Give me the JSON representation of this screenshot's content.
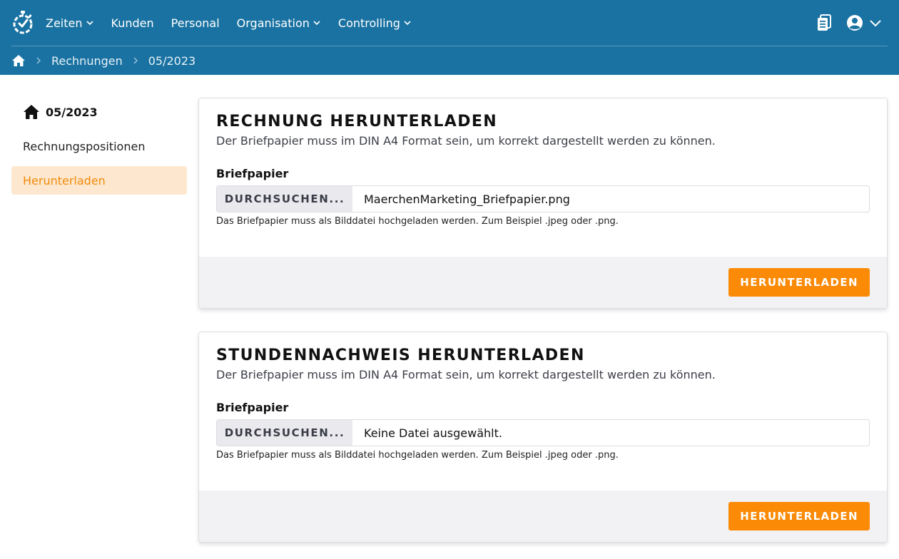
{
  "nav": {
    "items": [
      {
        "label": "Zeiten",
        "has_dropdown": true
      },
      {
        "label": "Kunden",
        "has_dropdown": false
      },
      {
        "label": "Personal",
        "has_dropdown": false
      },
      {
        "label": "Organisation",
        "has_dropdown": true
      },
      {
        "label": "Controlling",
        "has_dropdown": true
      }
    ],
    "logo_icon": "stopwatch-logo-icon",
    "right_icons": [
      "clipboard-icon",
      "user-circle-icon",
      "chevron-down-icon"
    ]
  },
  "breadcrumb": {
    "home_icon": "home-icon",
    "items": [
      "Rechnungen",
      "05/2023"
    ]
  },
  "sidebar": {
    "title": "05/2023",
    "items": [
      {
        "label": "Rechnungspositionen",
        "active": false
      },
      {
        "label": "Herunterladen",
        "active": true
      }
    ]
  },
  "cards": [
    {
      "title": "RECHNUNG HERUNTERLADEN",
      "subtitle": "Der Briefpapier muss im DIN A4 Format sein, um korrekt dargestellt werden zu können.",
      "field_label": "Briefpapier",
      "browse_label": "DURCHSUCHEN...",
      "file_name": "MaerchenMarketing_Briefpapier.png",
      "hint": "Das Briefpapier muss als Bilddatei hochgeladen werden. Zum Beispiel .jpeg oder .png.",
      "button_label": "HERUNTERLADEN"
    },
    {
      "title": "STUNDENNACHWEIS HERUNTERLADEN",
      "subtitle": "Der Briefpapier muss im DIN A4 Format sein, um korrekt dargestellt werden zu können.",
      "field_label": "Briefpapier",
      "browse_label": "DURCHSUCHEN...",
      "file_name": "Keine Datei ausgewählt.",
      "hint": "Das Briefpapier muss als Bilddatei hochgeladen werden. Zum Beispiel .jpeg oder .png.",
      "button_label": "HERUNTERLADEN"
    }
  ],
  "colors": {
    "header_bg": "#1972a2",
    "accent_orange": "#fb8a06",
    "active_item_bg": "#fde8cf",
    "footer_bg": "#f2f2f4"
  }
}
